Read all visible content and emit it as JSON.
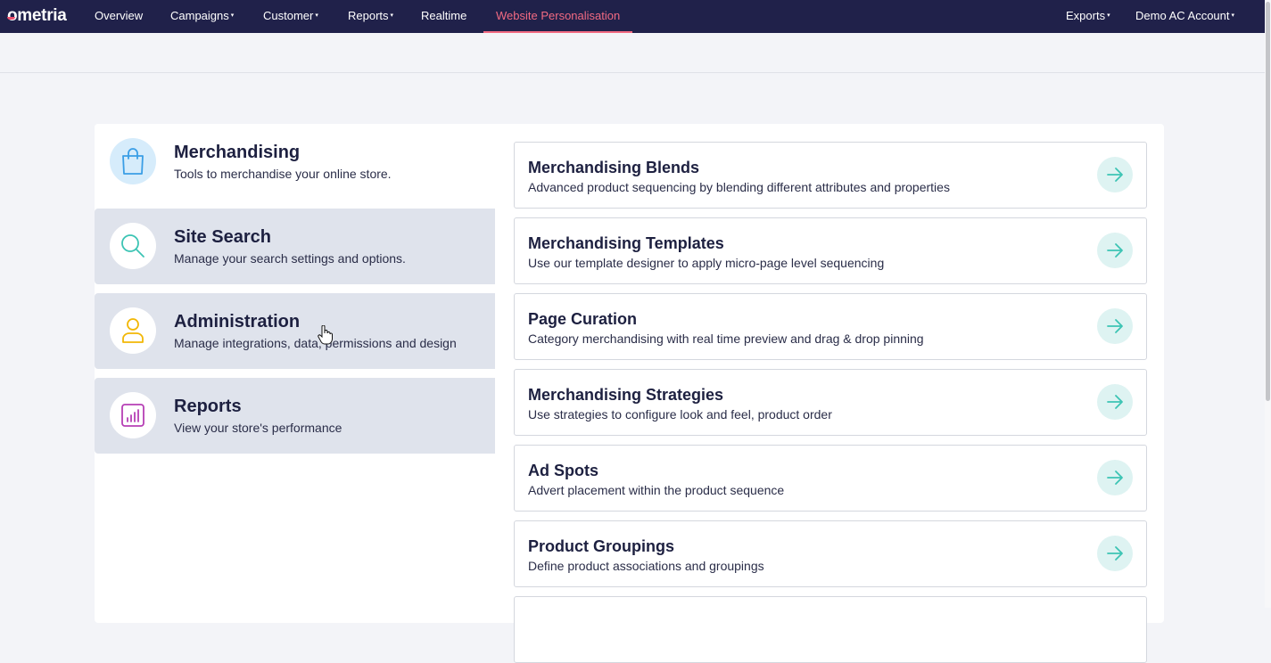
{
  "nav": {
    "logo": "ometria",
    "items": [
      {
        "label": "Overview",
        "has_caret": false
      },
      {
        "label": "Campaigns",
        "has_caret": true
      },
      {
        "label": "Customer",
        "has_caret": true
      },
      {
        "label": "Reports",
        "has_caret": true
      },
      {
        "label": "Realtime",
        "has_caret": false
      },
      {
        "label": "Website Personalisation",
        "has_caret": false,
        "active": true
      }
    ],
    "right_items": [
      {
        "label": "Exports",
        "has_caret": true
      },
      {
        "label": "Demo AC Account",
        "has_caret": true
      }
    ],
    "caret_glyph": "▾"
  },
  "categories": [
    {
      "title": "Merchandising",
      "desc": "Tools to merchandise your online store.",
      "icon": "shopping-bag-icon",
      "active": true
    },
    {
      "title": "Site Search",
      "desc": "Manage your search settings and options.",
      "icon": "search-icon"
    },
    {
      "title": "Administration",
      "desc": "Manage integrations, data, permissions and design",
      "icon": "user-icon"
    },
    {
      "title": "Reports",
      "desc": "View your store's performance",
      "icon": "bar-chart-icon"
    }
  ],
  "tools": [
    {
      "title": "Merchandising Blends",
      "desc": "Advanced product sequencing by blending different attributes and properties"
    },
    {
      "title": "Merchandising Templates",
      "desc": "Use our template designer to apply micro-page level sequencing"
    },
    {
      "title": "Page Curation",
      "desc": "Category merchandising with real time preview and drag & drop pinning"
    },
    {
      "title": "Merchandising Strategies",
      "desc": "Use strategies to configure look and feel, product order"
    },
    {
      "title": "Ad Spots",
      "desc": "Advert placement within the product sequence"
    },
    {
      "title": "Product Groupings",
      "desc": "Define product associations and groupings"
    },
    {
      "title": "",
      "desc": ""
    }
  ],
  "colors": {
    "nav_bg": "#20214a",
    "active_accent": "#f26a82",
    "arrow_color": "#3cc4b4",
    "arrow_bg": "#def3f2",
    "bag_icon": "#3a9ee6",
    "search_icon": "#3cc4b4",
    "user_icon": "#f2b705",
    "chart_icon": "#b63fb5"
  }
}
